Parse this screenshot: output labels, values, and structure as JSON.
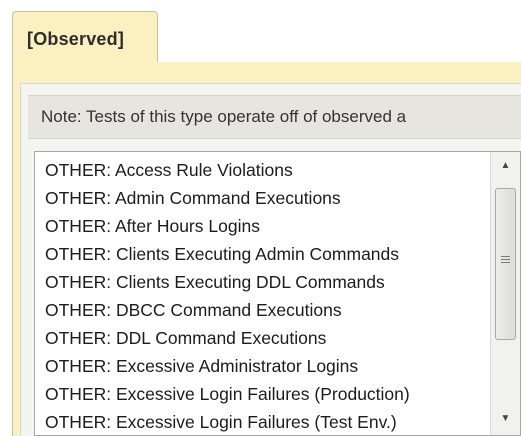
{
  "tab": {
    "label": "[Observed]"
  },
  "note": {
    "text": "Note: Tests of this type operate off of observed a"
  },
  "list": {
    "items": [
      "OTHER: Access Rule Violations",
      "OTHER: Admin Command Executions",
      "OTHER: After Hours Logins",
      "OTHER: Clients Executing Admin Commands",
      "OTHER: Clients Executing DDL Commands",
      "OTHER: DBCC Command Executions",
      "OTHER: DDL Command Executions",
      "OTHER: Excessive Administrator Logins",
      "OTHER: Excessive Login Failures (Production)",
      "OTHER: Excessive Login Failures (Test Env.)"
    ]
  },
  "scrollbar": {
    "up_icon": "▲",
    "down_icon": "▼"
  },
  "colors": {
    "tab_background": "#fbf0bf",
    "note_background": "#e6e5e0",
    "list_background": "#ffffff"
  }
}
